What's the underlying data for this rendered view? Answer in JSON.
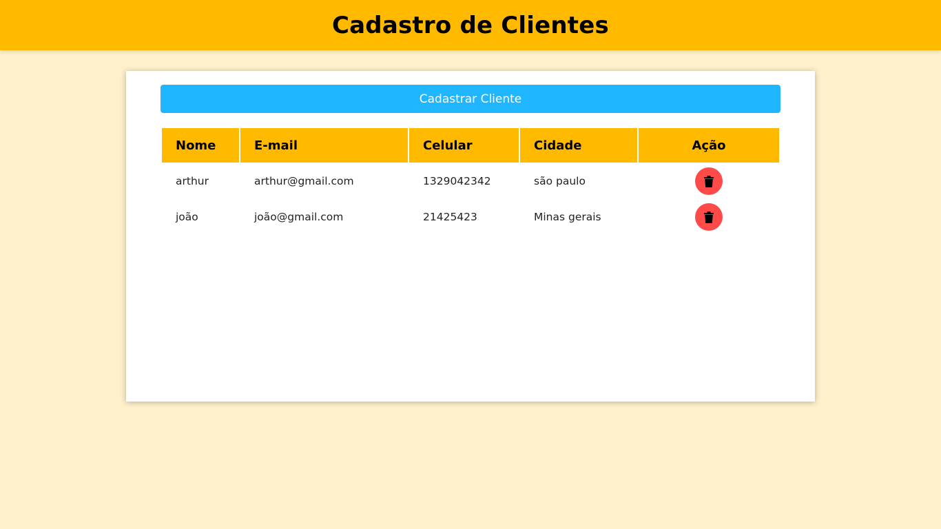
{
  "header": {
    "title": "Cadastro de Clientes"
  },
  "toolbar": {
    "add_label": "Cadastrar Cliente"
  },
  "table": {
    "columns": [
      "Nome",
      "E-mail",
      "Celular",
      "Cidade",
      "Ação"
    ],
    "rows": [
      {
        "nome": "arthur",
        "email": "arthur@gmail.com",
        "celular": "1329042342",
        "cidade": "são paulo"
      },
      {
        "nome": "joão",
        "email": "joão@gmail.com",
        "celular": "21425423",
        "cidade": "Minas gerais"
      }
    ]
  },
  "icons": {
    "delete": "trash-icon"
  },
  "colors": {
    "header_bg": "#ffba00",
    "page_bg": "#fff0cc",
    "primary_button": "#1fb6ff",
    "delete_button": "#ff4a4a"
  }
}
